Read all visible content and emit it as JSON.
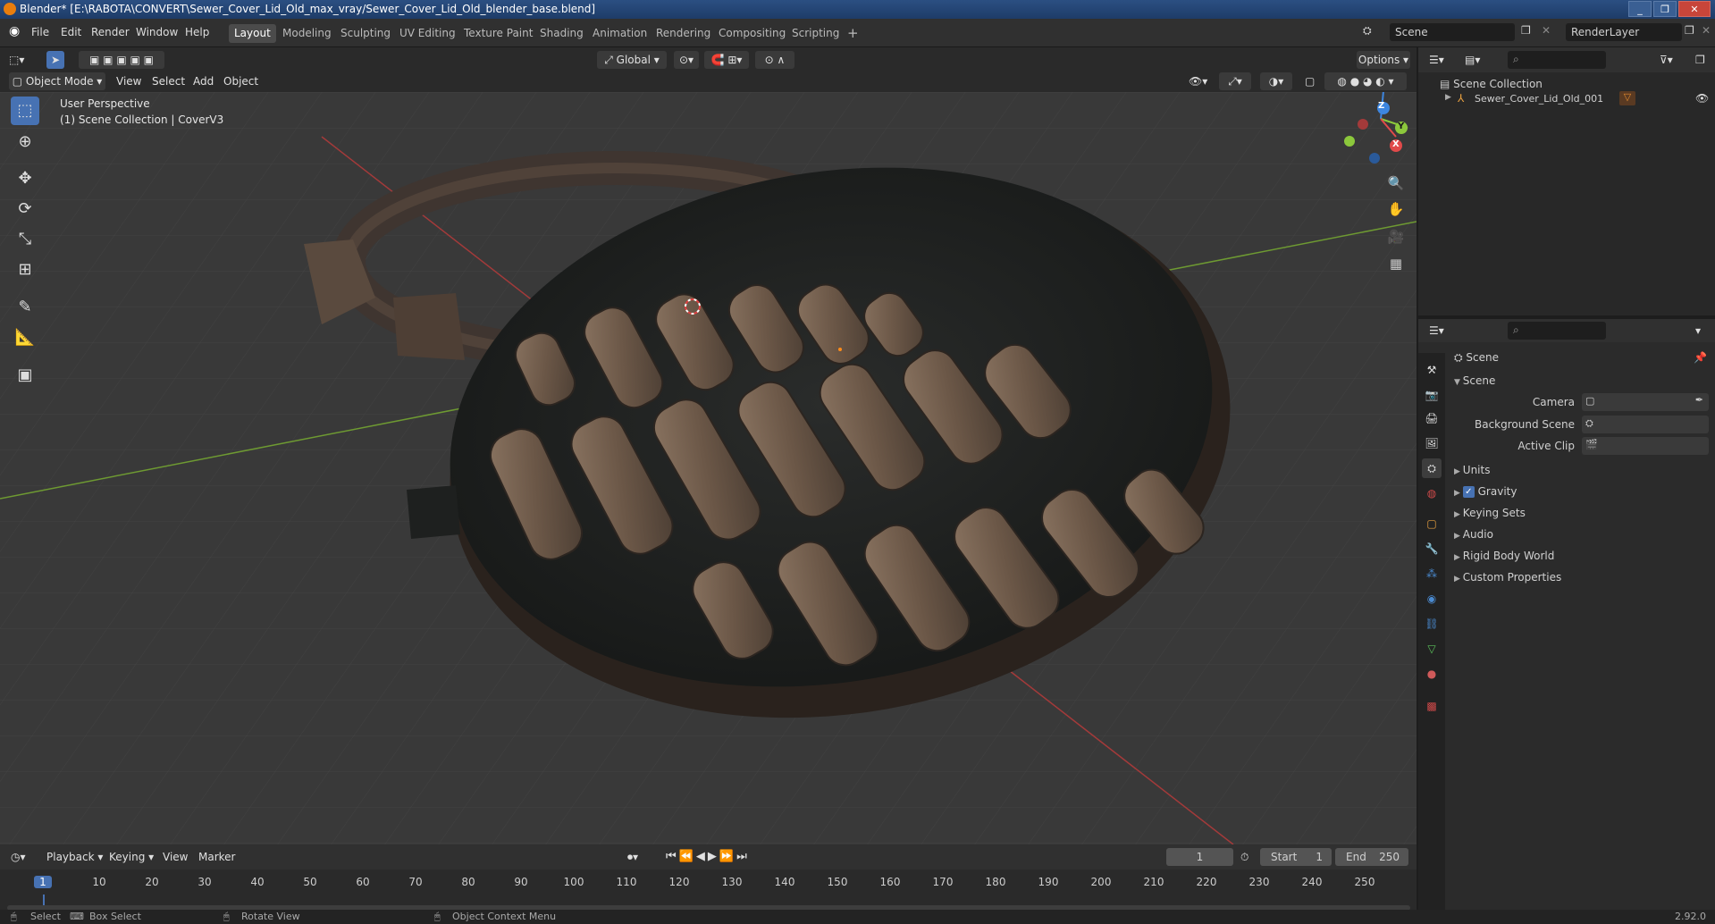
{
  "window": {
    "title": "Blender* [E:\\RABOTA\\CONVERT\\Sewer_Cover_Lid_Old_max_vray/Sewer_Cover_Lid_Old_blender_base.blend]",
    "buttons": [
      "_",
      "❐",
      "✕"
    ]
  },
  "menu": [
    "File",
    "Edit",
    "Render",
    "Window",
    "Help"
  ],
  "workspaces": [
    "Layout",
    "Modeling",
    "Sculpting",
    "UV Editing",
    "Texture Paint",
    "Shading",
    "Animation",
    "Rendering",
    "Compositing",
    "Scripting"
  ],
  "workspace_add": "+",
  "scene_field": "Scene",
  "renderlayer_field": "RenderLayer",
  "viewport_header": {
    "orientation": "Global",
    "options": "Options",
    "mode": "Object Mode",
    "menus": [
      "View",
      "Select",
      "Add",
      "Object"
    ]
  },
  "viewport_overlay": {
    "perspective": "User Perspective",
    "collection": "(1) Scene Collection | CoverV3"
  },
  "gizmo": {
    "z": "Z",
    "y": "Y",
    "x": "X"
  },
  "outliner": {
    "root": "Scene Collection",
    "items": [
      {
        "label": "Sewer_Cover_Lid_Old_001"
      }
    ]
  },
  "properties": {
    "context": "Scene",
    "panel": "Scene",
    "fields": [
      {
        "label": "Camera"
      },
      {
        "label": "Background Scene"
      },
      {
        "label": "Active Clip"
      }
    ],
    "sections": [
      "Units",
      "Gravity",
      "Keying Sets",
      "Audio",
      "Rigid Body World",
      "Custom Properties"
    ],
    "gravity_checked": true
  },
  "timeline": {
    "menus": [
      "Playback",
      "Keying",
      "View",
      "Marker"
    ],
    "current_frame": "1",
    "start_label": "Start",
    "start": "1",
    "end_label": "End",
    "end": "250",
    "ruler": [
      "1",
      "10",
      "20",
      "30",
      "40",
      "50",
      "60",
      "70",
      "80",
      "90",
      "100",
      "110",
      "120",
      "130",
      "140",
      "150",
      "160",
      "170",
      "180",
      "190",
      "200",
      "210",
      "220",
      "230",
      "240",
      "250"
    ]
  },
  "status": {
    "items": [
      "Select",
      "Box Select",
      "Rotate View",
      "Object Context Menu"
    ],
    "version": "2.92.0"
  },
  "colors": {
    "accent": "#4772b3",
    "viewport_bg": "#393939",
    "axis_x": "#e14a4a",
    "axis_y": "#8cc83c",
    "axis_z": "#3d86e0"
  }
}
